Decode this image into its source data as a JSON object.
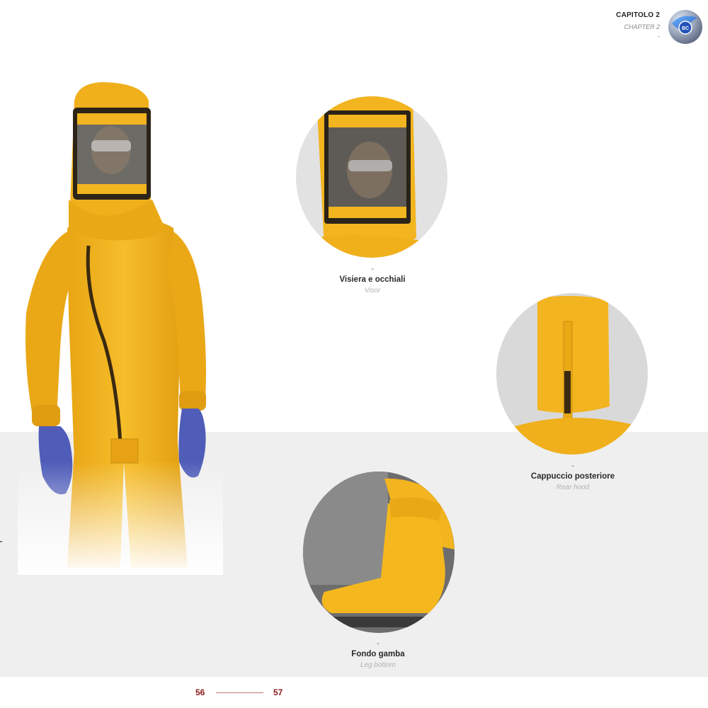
{
  "header": {
    "chapter_it": "CAPITOLO 2",
    "chapter_en": "CHAPTER 2",
    "dash": "-",
    "logo_text": "BC"
  },
  "details": [
    {
      "dash": "-",
      "title_it": "Visiera e occhiali",
      "title_en": "Visor"
    },
    {
      "dash": "-",
      "title_it": "Cappuccio posteriore",
      "title_en": "Rear hood"
    },
    {
      "dash": "-",
      "title_it": "Fondo gamba",
      "title_en": "Leg bottom"
    }
  ],
  "footer": {
    "page_left": "56",
    "page_right": "57"
  },
  "colors": {
    "suit_yellow": "#f2b41f",
    "zip_dark": "#3a2a10",
    "glove_blue": "#4f5db8",
    "page_number": "#8b1a1a",
    "band_gray": "#efefef"
  }
}
